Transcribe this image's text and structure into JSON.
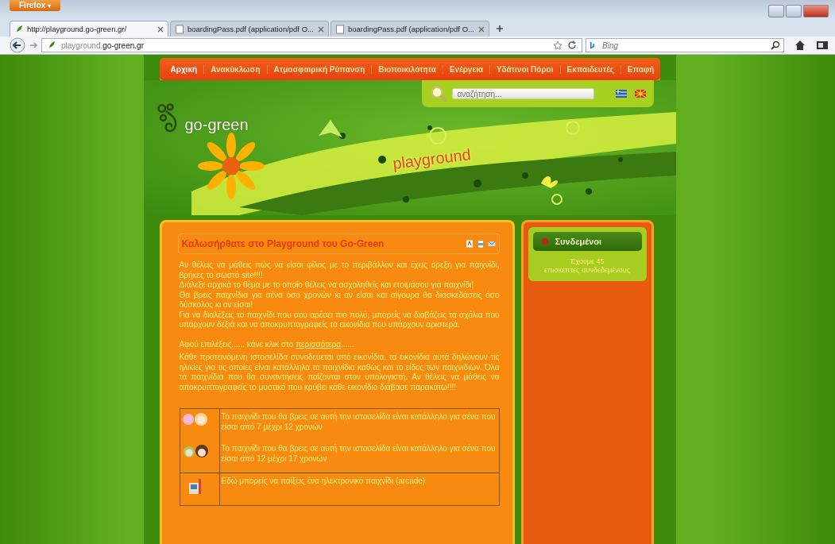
{
  "browser": {
    "menu_button": "Firefox",
    "menu_caret": "▾",
    "tabs": [
      {
        "label": "http://playground.go-green.gr/",
        "selected": true,
        "kind": "site"
      },
      {
        "label": "boardingPass.pdf (application/pdf O...",
        "selected": false,
        "kind": "document"
      },
      {
        "label": "boardingPass.pdf (application/pdf O...",
        "selected": false,
        "kind": "document"
      }
    ],
    "address_prefix": "playground.",
    "address_domain": "go-green.gr",
    "search_placeholder": "Bing"
  },
  "site": {
    "nav": [
      {
        "label": "Αρχική",
        "selected": true
      },
      {
        "label": "Ανακύκλωση",
        "selected": false
      },
      {
        "label": "Ατμοσφαιρική Ρύπανση",
        "selected": false
      },
      {
        "label": "Βιοποικιλότητα",
        "selected": false
      },
      {
        "label": "Ενέργεια",
        "selected": false
      },
      {
        "label": "Υδάτινοι Πόροι",
        "selected": false
      },
      {
        "label": "Εκπαιδευτές",
        "selected": false
      },
      {
        "label": "Επαφή",
        "selected": false
      }
    ],
    "search_placeholder": "αναζήτηση...",
    "logo": "go-green",
    "banner_label": "playground",
    "article": {
      "title": "Καλωσήρθατε στο Playground του Go-Green",
      "lines": [
        "Αν θέλεις να μάθεις πώς να είσαι φίλος με το περιβάλλον και έχεις όρεξη για παιχνίδι, βρήκες το σωστό site!!!!",
        "Διάλεξε αρχικά το θέμα με το οποίο θέλεις να ασχοληθείς και ετοιμάσου για παιχνίδι!",
        "Θα βρεις παιχνίδια για σένα όσο χρονών κι αν είσαι και σίγουρα θα διασκεδάσεις όσο δύσκολος κι αν είσαι!",
        "Για να διαλέξεις το παιχνίδι που σου αρέσει πιο πολύ, μπορείς να διαβάζεις τα σχόλια που υπάρχουν δεξιά και να αποκρυπτογραφείς τα εικονίδια που υπάρχουν αριστερά."
      ],
      "click_before": "Αφού επιλέξεις...... κάνε κλικ στο",
      "click_link": "περισσότερα",
      "click_after": "......",
      "explain": "Κάθε προτεινόμενη ιστοσελίδα συνοδεύεται από εικονίδια, τα εικονίδια αυτά δηλώνουν τις ηλικίες για τις οποίες είναι κατάλληλα τα παιχνίδια καθώς και το είδος των παιχνιδιών. Όλα τα παιχνίδια που θα συναντήσεις παίζονται στον υπολογιστή. Αν θέλεις να μάθεις να αποκρυπτογραφείς το μυστικό που κρύβει κάθε εικονίδιο διάβασε παρακάτω!!!!",
      "legend": [
        {
          "kind": "young",
          "text": "Το παιχνίδι που θα βρεις σε αυτή την ιστοσελίδα είναι κατάλληλο για σένα που είσαι από 7 μέχρι 12 χρονών"
        },
        {
          "kind": "teen",
          "text": "Το παιχνίδι που θα βρεις σε αυτή την ιστοσελίδα είναι κατάλληλο για σένα που είσαι από 12 μέχρι 17 χρονών"
        },
        {
          "kind": "arcade",
          "text": "Εδώ μπορείς να παίξεις ένα ηλεκτρονικό παιχνίδι (arcade)"
        }
      ]
    },
    "online": {
      "title": "Συνδεμένοι",
      "text_1": "Έχουμε 45",
      "text_2": "επισκέπτες συνδεδεμένους"
    }
  }
}
